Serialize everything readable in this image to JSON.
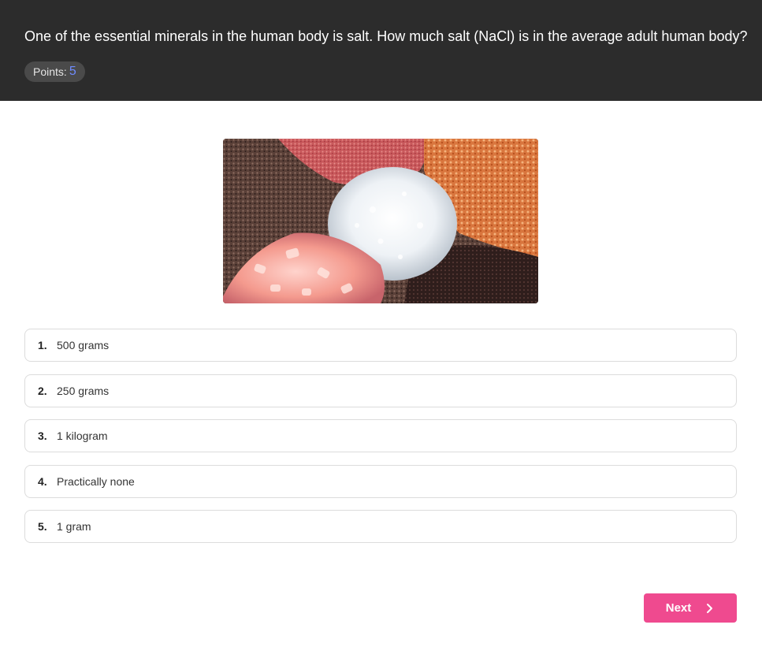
{
  "question": {
    "text": "One of the essential minerals in the human body is salt. How much salt (NaCl) is in the average adult human body?",
    "points_label": "Points:",
    "points_value": "5"
  },
  "image": {
    "alt": "Various colored salt crystals"
  },
  "options": [
    {
      "number": "1.",
      "label": "500 grams"
    },
    {
      "number": "2.",
      "label": "250 grams"
    },
    {
      "number": "3.",
      "label": "1 kilogram"
    },
    {
      "number": "4.",
      "label": "Practically none"
    },
    {
      "number": "5.",
      "label": "1 gram"
    }
  ],
  "navigation": {
    "next_label": "Next",
    "next_icon": "chevron-right-icon"
  },
  "colors": {
    "header_bg": "#2c2c2c",
    "accent": "#ef4a8f",
    "points_value": "#6f8cff"
  }
}
